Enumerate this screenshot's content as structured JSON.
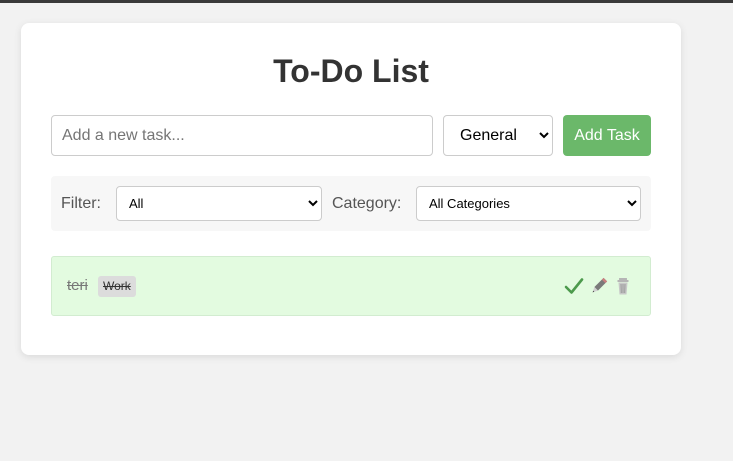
{
  "app": {
    "title": "To-Do List"
  },
  "new_task": {
    "placeholder": "Add a new task...",
    "value": "",
    "category_selected": "General",
    "add_button_label": "Add Task"
  },
  "filters": {
    "status_label": "Filter:",
    "status_selected": "All",
    "category_label": "Category:",
    "category_selected": "All Categories"
  },
  "tasks": [
    {
      "text": "teri",
      "category": "Work",
      "completed": true
    }
  ],
  "icons": {
    "complete": "checkmark-icon",
    "edit": "pencil-icon",
    "delete": "trash-icon"
  },
  "colors": {
    "accent": "#6bb86a",
    "completed_bg": "#e3fbe0",
    "check": "#4c9a4c",
    "page_bg": "#f2f2f2"
  }
}
